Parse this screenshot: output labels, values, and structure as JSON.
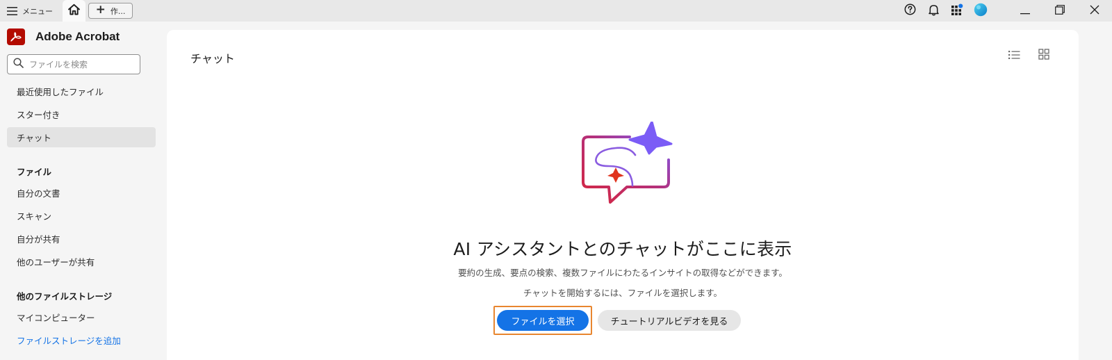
{
  "titlebar": {
    "menu_label": "メニュー",
    "new_tab_label": "作...",
    "icons": [
      "menu-icon",
      "home-icon",
      "plus-icon",
      "help-icon",
      "bell-icon",
      "apps-icon",
      "avatar",
      "minimize-icon",
      "restore-icon",
      "close-icon"
    ]
  },
  "app": {
    "name": "Adobe Acrobat",
    "brand_color": "#b30b00"
  },
  "search": {
    "placeholder": "ファイルを検索"
  },
  "sidebar": {
    "items": [
      {
        "label": "最近使用したファイル",
        "active": false
      },
      {
        "label": "スター付き",
        "active": false
      },
      {
        "label": "チャット",
        "active": true
      }
    ],
    "files_section": {
      "heading": "ファイル",
      "items": [
        {
          "label": "自分の文書"
        },
        {
          "label": "スキャン"
        },
        {
          "label": "自分が共有"
        },
        {
          "label": "他のユーザーが共有"
        }
      ]
    },
    "storage_section": {
      "heading": "他のファイルストレージ",
      "items": [
        {
          "label": "マイコンピューター"
        },
        {
          "label": "ファイルストレージを追加",
          "link": true
        }
      ]
    }
  },
  "main": {
    "title": "チャット",
    "view_options": [
      "list-view-icon",
      "grid-view-icon"
    ],
    "empty_state": {
      "illustration": "chat-sparkle-illustration",
      "heading": "AI アシスタントとのチャットがここに表示",
      "description_1": "要約の生成、要点の検索、複数ファイルにわたるインサイトの取得などができます。",
      "description_2": "チャットを開始するには、ファイルを選択します。",
      "primary_button": "ファイルを選択",
      "secondary_button": "チュートリアルビデオを見る"
    }
  },
  "colors": {
    "accent": "#1473e6",
    "focus_ring": "#e8862f",
    "sparkle_purple": "#7b5cf6",
    "bubble_red": "#d7263d"
  }
}
